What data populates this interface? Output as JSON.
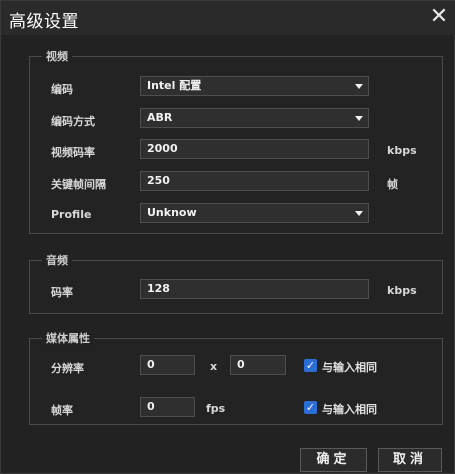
{
  "dialog": {
    "title": "高级设置",
    "close_icon": "close-icon"
  },
  "video": {
    "legend": "视频",
    "encoder_label": "编码",
    "encoder_value": "Intel 配置",
    "mode_label": "编码方式",
    "mode_value": "ABR",
    "bitrate_label": "视频码率",
    "bitrate_value": "2000",
    "bitrate_unit": "kbps",
    "keyframe_label": "关键帧间隔",
    "keyframe_value": "250",
    "keyframe_unit": "帧",
    "profile_label": "Profile",
    "profile_value": "Unknow"
  },
  "audio": {
    "legend": "音频",
    "bitrate_label": "码率",
    "bitrate_value": "128",
    "bitrate_unit": "kbps"
  },
  "media": {
    "legend": "媒体属性",
    "resolution_label": "分辨率",
    "width_value": "0",
    "separator": "x",
    "height_value": "0",
    "resolution_same_label": "与输入相同",
    "fps_label": "帧率",
    "fps_value": "0",
    "fps_unit": "fps",
    "fps_same_label": "与输入相同"
  },
  "buttons": {
    "ok": "确定",
    "cancel": "取消"
  },
  "colors": {
    "background": "#222222",
    "checkbox": "#2b6fd6"
  }
}
